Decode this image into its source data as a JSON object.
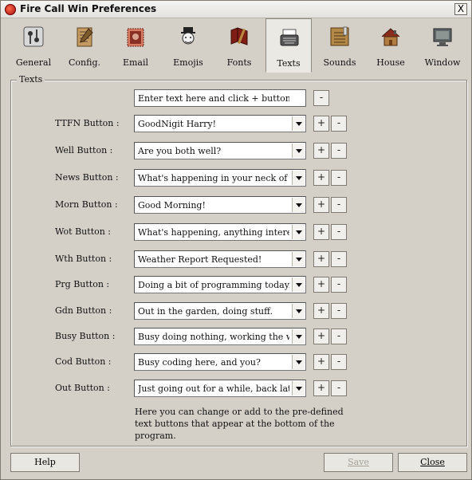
{
  "window": {
    "title": "Fire Call Win Preferences",
    "close_label": "X"
  },
  "tabs": [
    {
      "label": "General",
      "icon": "switch-icon"
    },
    {
      "label": "Config.",
      "icon": "notepad-icon"
    },
    {
      "label": "Email",
      "icon": "stamp-icon"
    },
    {
      "label": "Emojis",
      "icon": "gentleman-icon"
    },
    {
      "label": "Fonts",
      "icon": "book-icon"
    },
    {
      "label": "Texts",
      "icon": "typewriter-icon"
    },
    {
      "label": "Sounds",
      "icon": "speaker-icon"
    },
    {
      "label": "House",
      "icon": "house-icon"
    },
    {
      "label": "Window",
      "icon": "window-icon"
    }
  ],
  "texts_group": {
    "label": "Texts",
    "entry_placeholder": "Enter text here and click + button below",
    "rows": [
      {
        "label": "TTFN Button :",
        "value": "GoodNigit Harry!"
      },
      {
        "label": "Well Button :",
        "value": "Are you both well?"
      },
      {
        "label": "News Button :",
        "value": "What's happening in your neck of the woo"
      },
      {
        "label": "Morn Button :",
        "value": "Good Morning!"
      },
      {
        "label": "Wot Button :",
        "value": "What's happening, anything interesting?"
      },
      {
        "label": "Wth Button :",
        "value": "Weather Report Requested!"
      },
      {
        "label": "Prg Button :",
        "value": "Doing a bit of programming today..."
      },
      {
        "label": "Gdn Button :",
        "value": "Out in the garden, doing stuff."
      },
      {
        "label": "Busy Button :",
        "value": "Busy doing nothing, working the whole da"
      },
      {
        "label": "Cod Button :",
        "value": "Busy coding here, and you?"
      },
      {
        "label": "Out Button :",
        "value": "Just going out for a while, back later!"
      }
    ],
    "plus": "+",
    "minus": "-",
    "note": "Here you can change or add to the pre-defined text buttons that appear at the bottom of the program."
  },
  "footer": {
    "help": "Help",
    "save": "Save",
    "close": "Close"
  }
}
